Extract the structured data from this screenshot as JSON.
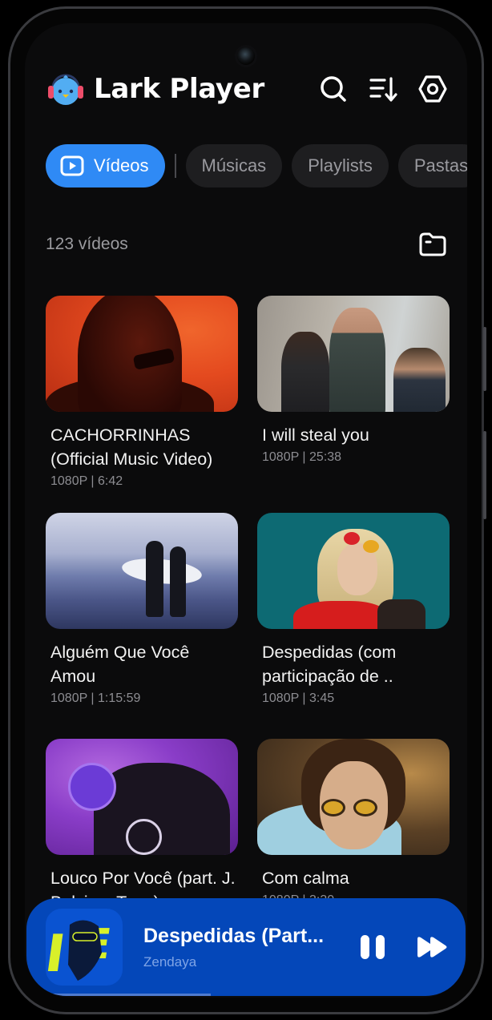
{
  "app": {
    "title": "Lark Player",
    "brand_color": "#2f8af5"
  },
  "header": {
    "actions": [
      {
        "name": "search",
        "icon": "search-icon"
      },
      {
        "name": "sort",
        "icon": "sort-icon"
      },
      {
        "name": "settings",
        "icon": "settings-icon"
      }
    ]
  },
  "tabs": [
    {
      "label": "Vídeos",
      "active": true,
      "icon": "video-icon"
    },
    {
      "label": "Músicas",
      "active": false
    },
    {
      "label": "Playlists",
      "active": false
    },
    {
      "label": "Pastas",
      "active": false
    }
  ],
  "library": {
    "count_label": "123 vídeos",
    "folder_icon": "folder-icon"
  },
  "videos": [
    {
      "title": "CACHORRINHAS (Official Music Video)",
      "meta": "1080P | 6:42"
    },
    {
      "title": "I will steal you",
      "meta": "1080P | 25:38"
    },
    {
      "title": "Alguém Que Você Amou",
      "meta": "1080P | 1:15:59"
    },
    {
      "title": "Despedidas (com participação de ..",
      "meta": "1080P | 3:45"
    },
    {
      "title": "Louco Por Você (part. J. Balvin e Tyga)",
      "meta": ""
    },
    {
      "title": "Com calma",
      "meta": "1080P | 3:30"
    }
  ],
  "now_playing": {
    "title": "Despedidas (Part...",
    "artist": "Zendaya",
    "progress": 0.42,
    "controls": [
      "pause-icon",
      "fast-forward-icon"
    ]
  }
}
